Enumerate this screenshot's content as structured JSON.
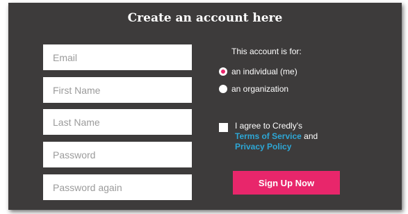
{
  "form": {
    "title": "Create an account here",
    "fields": {
      "email": {
        "placeholder": "Email",
        "value": ""
      },
      "first_name": {
        "placeholder": "First Name",
        "value": ""
      },
      "last_name": {
        "placeholder": "Last Name",
        "value": ""
      },
      "password": {
        "placeholder": "Password",
        "value": ""
      },
      "password_again": {
        "placeholder": "Password again",
        "value": ""
      }
    },
    "account_for_label": "This account is for:",
    "account_options": [
      {
        "label": "an individual (me)",
        "selected": true
      },
      {
        "label": "an organization",
        "selected": false
      }
    ],
    "agree": {
      "prefix": "I agree to Credly's",
      "terms_link": "Terms of Service",
      "and": "and",
      "privacy_link": "Privacy Policy",
      "checked": false
    },
    "submit_label": "Sign Up Now"
  },
  "colors": {
    "panel_bg": "#3d3b3b",
    "accent": "#e8266b",
    "link": "#2da7d6"
  }
}
